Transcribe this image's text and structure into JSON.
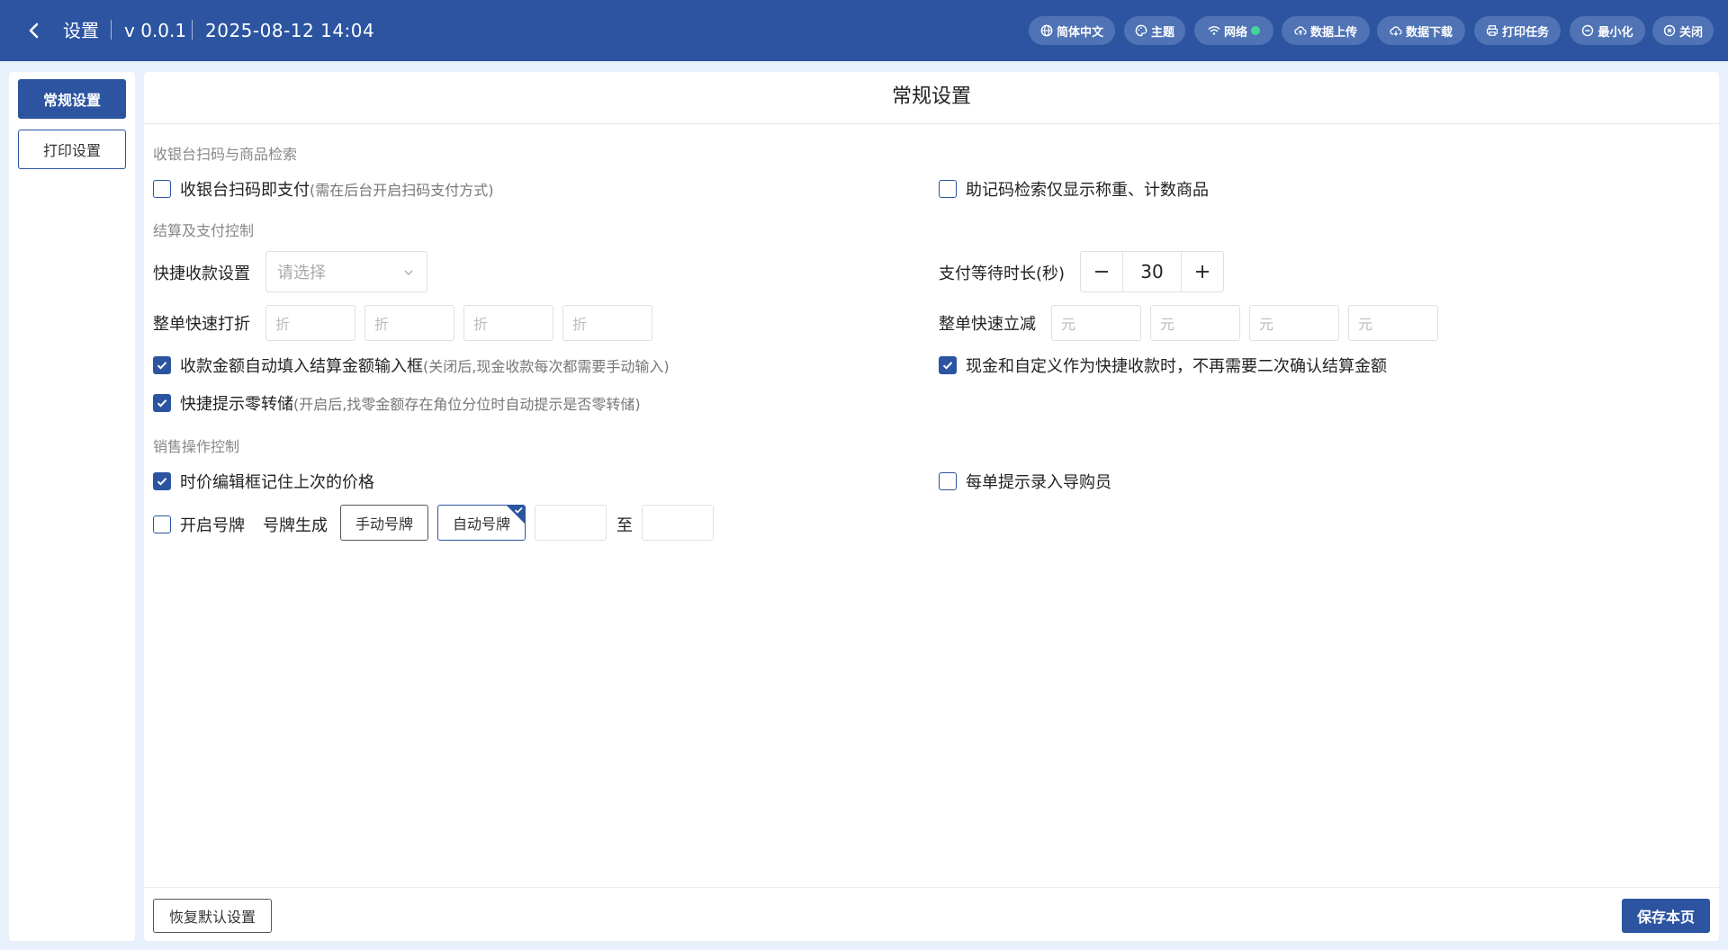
{
  "header": {
    "title": "设置",
    "version": "v 0.0.1",
    "datetime": "2025-08-12 14:04",
    "buttons": {
      "language": "简体中文",
      "theme": "主题",
      "network": "网络",
      "upload": "数据上传",
      "download": "数据下载",
      "print_tasks": "打印任务",
      "minimize": "最小化",
      "close": "关闭"
    },
    "network_status_color": "#44d39a"
  },
  "sidebar": {
    "items": [
      {
        "label": "常规设置",
        "active": true
      },
      {
        "label": "打印设置",
        "active": false
      }
    ]
  },
  "main": {
    "title": "常规设置",
    "sections": {
      "scan": "收银台扫码与商品检索",
      "checkout": "结算及支付控制",
      "sales": "销售操作控制"
    },
    "options": {
      "scan_pay": {
        "label": "收银台扫码即支付",
        "hint": "(需在后台开启扫码支付方式)",
        "checked": false
      },
      "mnemonic": {
        "label": "助记码检索仅显示称重、计数商品",
        "checked": false
      },
      "auto_fill": {
        "label": "收款金额自动填入结算金额输入框",
        "hint": "(关闭后,现金收款每次都需要手动输入)",
        "checked": true
      },
      "cash_custom": {
        "label": "现金和自定义作为快捷收款时，不再需要二次确认结算金额",
        "checked": true
      },
      "change_store": {
        "label": "快捷提示零转储",
        "hint": "(开启后,找零金额存在角位分位时自动提示是否零转储)",
        "checked": true
      },
      "remember_price": {
        "label": "时价编辑框记住上次的价格",
        "checked": true
      },
      "guide_prompt": {
        "label": "每单提示录入导购员",
        "checked": false
      },
      "number_plate": {
        "label": "开启号牌",
        "checked": false
      }
    },
    "quick_pay": {
      "label": "快捷收款设置",
      "placeholder": "请选择"
    },
    "pay_wait": {
      "label": "支付等待时长(秒)",
      "value": "30"
    },
    "discount": {
      "label": "整单快速打折",
      "unit": "折"
    },
    "reduce": {
      "label": "整单快速立减",
      "unit": "元"
    },
    "plate_gen": {
      "label": "号牌生成",
      "manual": "手动号牌",
      "auto": "自动号牌",
      "to": "至"
    }
  },
  "footer": {
    "reset": "恢复默认设置",
    "save": "保存本页"
  },
  "colors": {
    "primary": "#2c54a0",
    "background": "#e8f1fb"
  }
}
